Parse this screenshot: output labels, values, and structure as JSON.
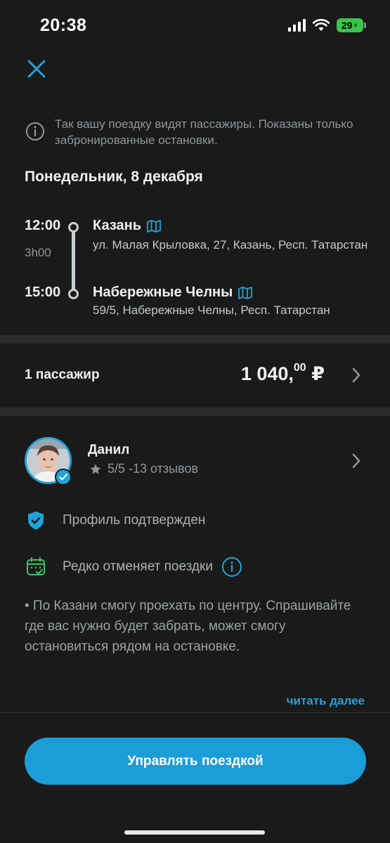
{
  "status_bar": {
    "time": "20:38",
    "battery": "29"
  },
  "info_note": {
    "text": "Так вашу поездку видят пассажиры. Показаны только забронированные остановки."
  },
  "trip": {
    "date": "Понедельник, 8 декабря",
    "duration": "3h00",
    "departure": {
      "time": "12:00",
      "city": "Казань",
      "address": "ул. Малая Крыловка, 27, Казань, Респ. Татарстан"
    },
    "arrival": {
      "time": "15:00",
      "city": "Набережные Челны",
      "address": "59/5, Набережные Челны, Респ. Татарстан"
    }
  },
  "passengers": {
    "label": "1 пассажир",
    "price_main": "1 040,",
    "price_cents": "00",
    "currency": "₽"
  },
  "driver": {
    "name": "Данил",
    "rating": "5/5 -13 отзывов"
  },
  "features": {
    "verified": "Профиль подтвержден",
    "rarely_cancels": "Редко отменяет поездки"
  },
  "bio": {
    "text": "• По Казани смогу проехать по центру. Спрашивайте где вас нужно будет забрать, может смогу остановиться рядом на остановке.",
    "read_more": "читать далее"
  },
  "cta": {
    "label": "Управлять поездкой"
  },
  "colors": {
    "accent": "#1b9dd8",
    "background": "#1a1a1a",
    "divider": "#2b2b2b",
    "success": "#3bc44b"
  },
  "icons": [
    "close-icon",
    "info-icon",
    "map-icon",
    "chevron-right-icon",
    "star-icon",
    "shield-check-icon",
    "calendar-check-icon"
  ]
}
